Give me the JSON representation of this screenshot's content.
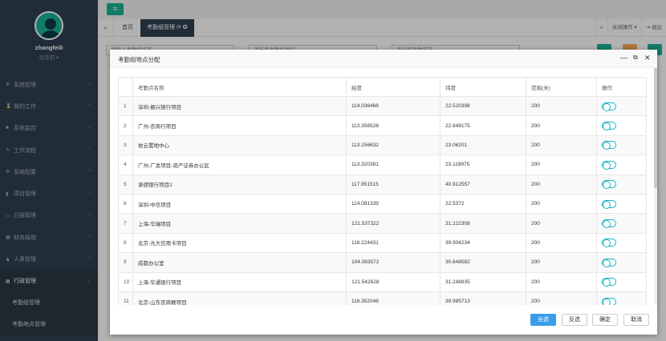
{
  "sidebar": {
    "username": "zhangfeili",
    "role": "张菲莉 ▾",
    "items": [
      {
        "label": "系统管理",
        "icon": "gear-icon",
        "glyph": "⚙"
      },
      {
        "label": "我的工作",
        "icon": "hourglass-icon",
        "glyph": "⌛"
      },
      {
        "label": "系统监控",
        "icon": "video-icon",
        "glyph": "■"
      },
      {
        "label": "工作流程",
        "icon": "wrench-icon",
        "glyph": "✎"
      },
      {
        "label": "系统配置",
        "icon": "cogs-icon",
        "glyph": "⚙"
      },
      {
        "label": "项目管理",
        "icon": "book-icon",
        "glyph": "▮"
      },
      {
        "label": "日报管理",
        "icon": "laptop-icon",
        "glyph": "▭"
      },
      {
        "label": "财务报销",
        "icon": "table-icon",
        "glyph": "▦"
      },
      {
        "label": "人事管理",
        "icon": "users-icon",
        "glyph": "♟"
      },
      {
        "label": "行政管理",
        "icon": "file-icon",
        "glyph": "▤"
      }
    ],
    "submenu": [
      "考勤组管理",
      "考勤地点管理"
    ]
  },
  "tabs": {
    "home": "首页",
    "active": "考勤组管理 ⟳ ✪",
    "close_ops": "关闭操作 ▾",
    "logout": "⇥ 退出"
  },
  "background": {
    "field1": "请输入考勤组名称",
    "field2": "请选择考勤组类型",
    "field3": "请选择考勤城市"
  },
  "modal": {
    "title": "考勤组地点分配",
    "columns": [
      "",
      "考勤点名称",
      "经度",
      "纬度",
      "范围(米)",
      "操作"
    ],
    "rows": [
      {
        "no": "1",
        "name": "深圳-振兴银行项目",
        "lng": "114.036466",
        "lat": "22.520398",
        "range": "200"
      },
      {
        "no": "2",
        "name": "广州-农商行项目",
        "lng": "113.358528",
        "lat": "22.949175",
        "range": "200"
      },
      {
        "no": "3",
        "name": "依云置地中心",
        "lng": "113.156632",
        "lat": "23.06201",
        "range": "200"
      },
      {
        "no": "4",
        "name": "广州-广发项目-资产证券办公区",
        "lng": "113.320381",
        "lat": "23.118975",
        "range": "200"
      },
      {
        "no": "5",
        "name": "承德银行项目2",
        "lng": "117.951515",
        "lat": "40.912557",
        "range": "200"
      },
      {
        "no": "6",
        "name": "深圳-中信项目",
        "lng": "114.081339",
        "lat": "22.5372",
        "range": "200"
      },
      {
        "no": "7",
        "name": "上海-华瑞项目",
        "lng": "121.537322",
        "lat": "31.222308",
        "range": "200"
      },
      {
        "no": "8",
        "name": "北京-光大信用卡项目",
        "lng": "116.224431",
        "lat": "39.904234",
        "range": "200"
      },
      {
        "no": "9",
        "name": "成都办公室",
        "lng": "104.083572",
        "lat": "30.648582",
        "range": "200"
      },
      {
        "no": "10",
        "name": "上海-华通银行项目",
        "lng": "121.542628",
        "lat": "31.248935",
        "range": "200"
      },
      {
        "no": "11",
        "name": "北京-山东农商联项目",
        "lng": "116.352046",
        "lat": "39.985713",
        "range": "200"
      }
    ],
    "buttons": {
      "select_all": "全选",
      "invert": "反选",
      "confirm": "确定",
      "cancel": "取消"
    }
  }
}
